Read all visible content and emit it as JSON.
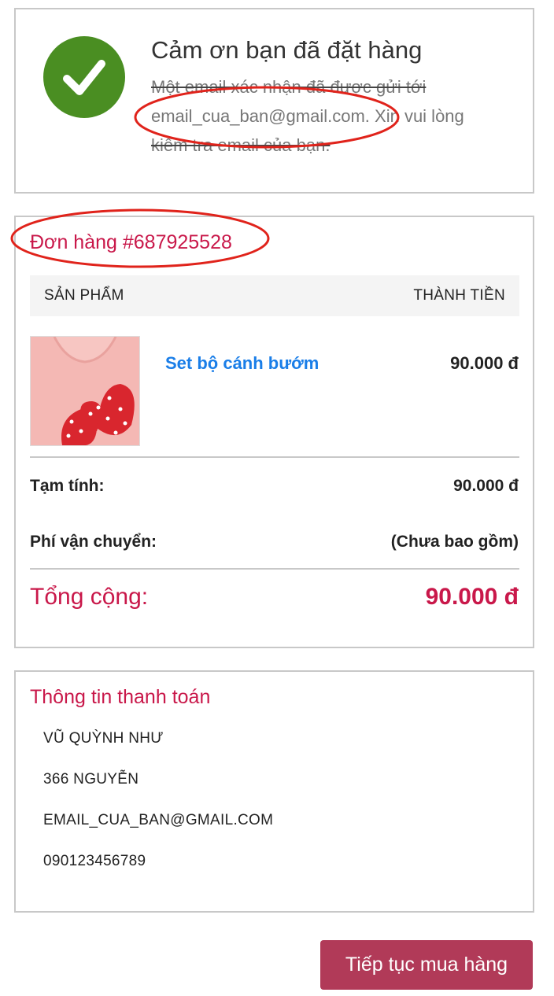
{
  "thanks": {
    "title": "Cảm ơn bạn đã đặt hàng",
    "line1": "Một email xác nhận đã được gửi tới",
    "email": "email_cua_ban@gmail.com.",
    "line2_rest": " Xin vui lòng",
    "line3": "kiểm tra email của bạn."
  },
  "order": {
    "title": "Đơn hàng #687925528",
    "col_product": "SẢN PHẨM",
    "col_total": "THÀNH TIỀN",
    "items": [
      {
        "name": "Set bộ cánh bướm",
        "price": "90.000 đ"
      }
    ],
    "subtotal_label": "Tạm tính:",
    "subtotal_value": "90.000 đ",
    "shipping_label": "Phí vận chuyển:",
    "shipping_value": "(Chưa bao gồm)",
    "total_label": "Tổng cộng:",
    "total_value": "90.000 đ"
  },
  "billing": {
    "title": "Thông tin thanh toán",
    "name": "VŨ QUỲNH NHƯ",
    "address": "366 NGUYỄN",
    "email": "EMAIL_CUA_BAN@GMAIL.COM",
    "phone": "090123456789"
  },
  "actions": {
    "continue_label": "Tiếp tục mua hàng"
  },
  "colors": {
    "accent": "#c9184a",
    "success": "#4a8e22",
    "link": "#1a7ee8",
    "button": "#b13a58",
    "annotation": "#e0231b"
  },
  "icons": {
    "check": "check-circle-icon"
  }
}
